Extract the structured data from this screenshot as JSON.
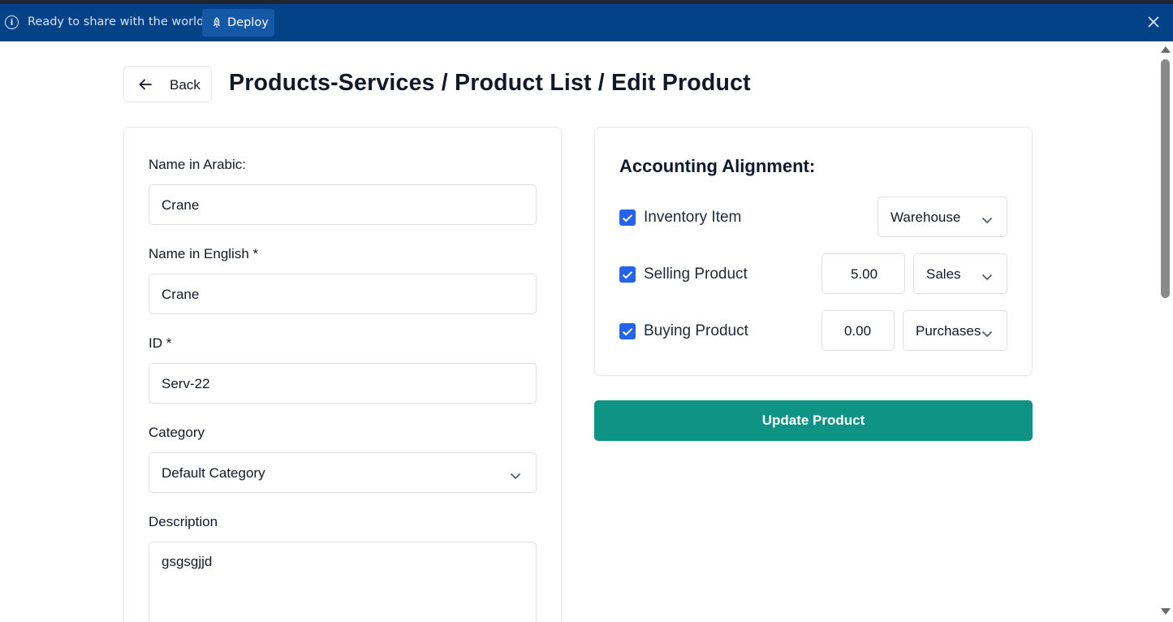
{
  "banner": {
    "message": "Ready to share with the world?",
    "deploy_label": "Deploy",
    "icons": [
      "info-icon",
      "rocket-icon",
      "close-icon"
    ],
    "color": "#034287"
  },
  "header": {
    "back_label": "Back",
    "title": "Products-Services / Product List / Edit Product"
  },
  "form": {
    "name_arabic": {
      "label": "Name in Arabic:",
      "value": "Crane"
    },
    "name_english": {
      "label": "Name in English *",
      "value": "Crane"
    },
    "id": {
      "label": "ID *",
      "value": "Serv-22"
    },
    "category": {
      "label": "Category",
      "value": "Default Category"
    },
    "description": {
      "label": "Description",
      "value": "gsgsgjjd"
    }
  },
  "accounting": {
    "title": "Accounting Alignment:",
    "inventory": {
      "label": "Inventory Item",
      "checked": true,
      "select": "Warehouse"
    },
    "selling": {
      "label": "Selling Product",
      "checked": true,
      "amount": "5.00",
      "select": "Sales"
    },
    "buying": {
      "label": "Buying Product",
      "checked": true,
      "amount": "0.00",
      "select": "Purchases"
    }
  },
  "actions": {
    "update_label": "Update Product"
  },
  "colors": {
    "accent": "#0f9384",
    "checkbox": "#2563eb"
  }
}
